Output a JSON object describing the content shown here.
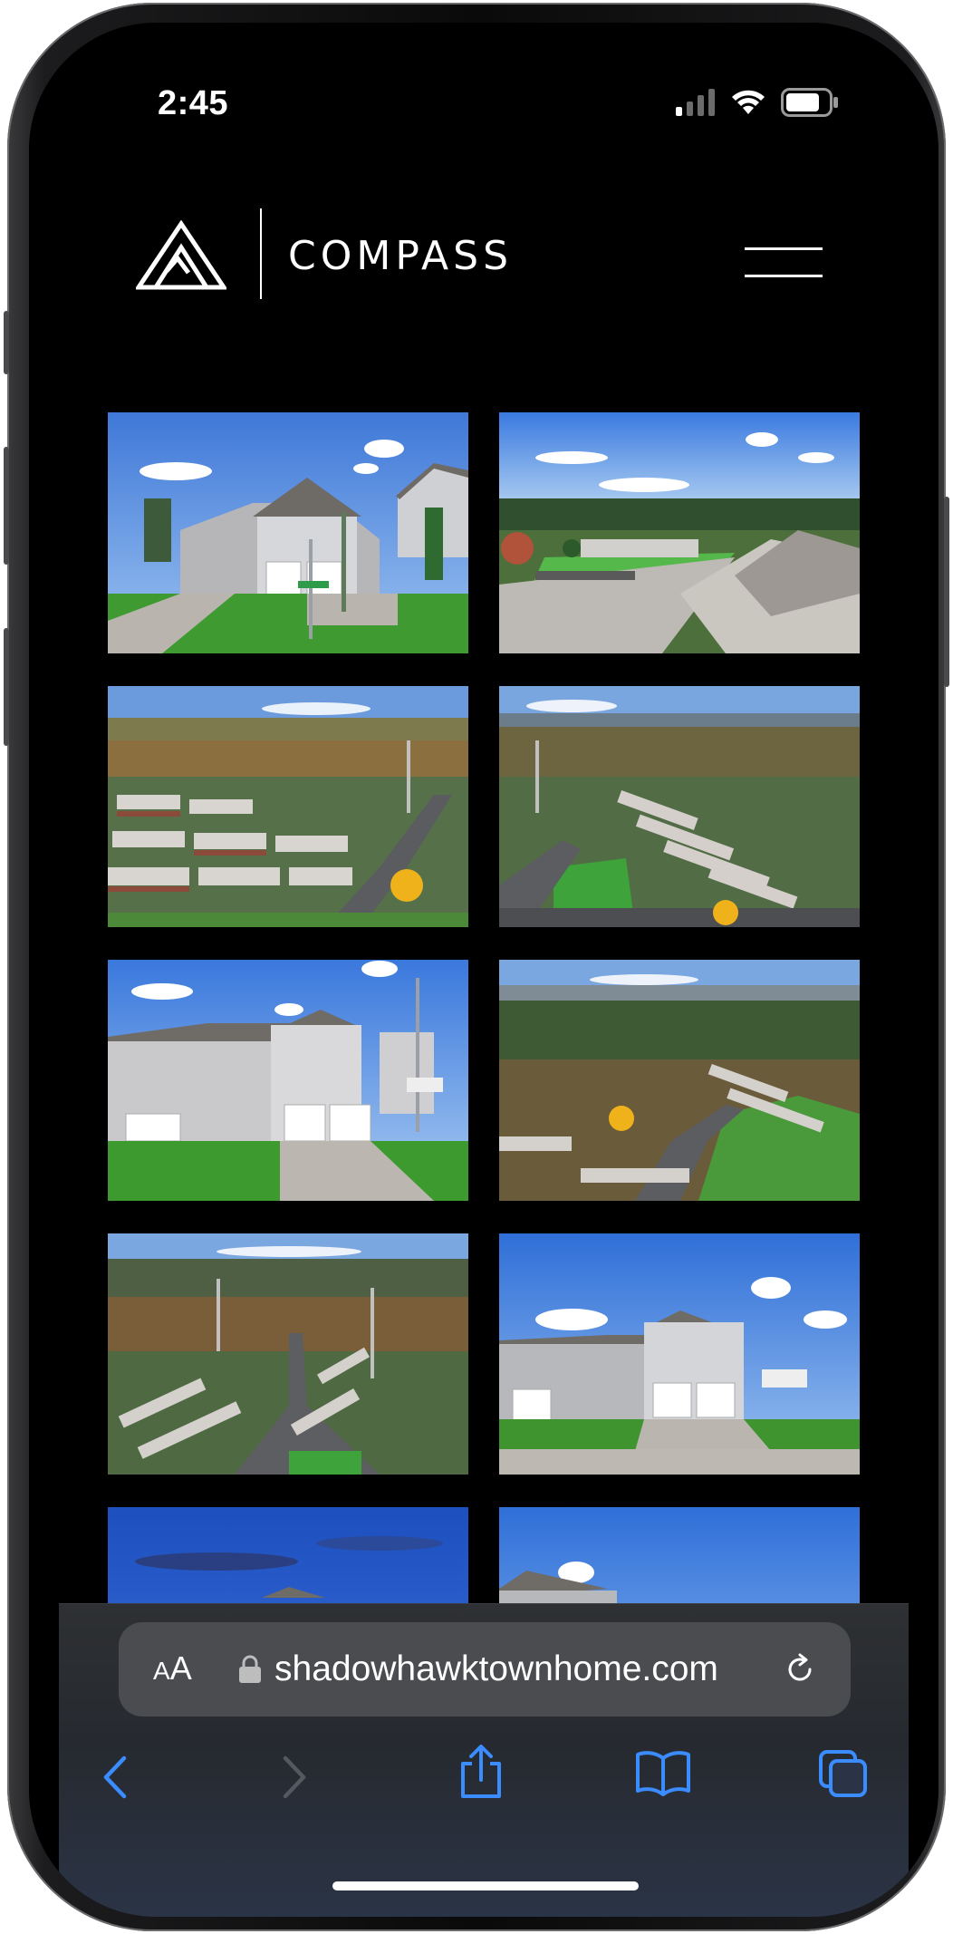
{
  "status_bar": {
    "time": "2:45",
    "signal_icon": "cellular-signal-icon",
    "wifi_icon": "wifi-icon",
    "battery_icon": "battery-icon"
  },
  "header": {
    "brand": "COMPASS",
    "logo_icon": "compass-mountain-logo",
    "menu_icon": "hamburger-menu-icon"
  },
  "gallery": {
    "photos": [
      {
        "subject": "house-front-corner"
      },
      {
        "subject": "aerial-parking-lot"
      },
      {
        "subject": "aerial-townhome-community"
      },
      {
        "subject": "aerial-neighborhood-wide"
      },
      {
        "subject": "house-front-garage"
      },
      {
        "subject": "aerial-valley-view"
      },
      {
        "subject": "aerial-powerlines-street"
      },
      {
        "subject": "house-front-wide"
      },
      {
        "subject": "evening-sky-house"
      },
      {
        "subject": "house-under-blue-sky"
      }
    ]
  },
  "browser": {
    "text_size_label": "AA",
    "url": "shadowhawktownhome.com",
    "lock_icon": "lock-icon",
    "reload_icon": "reload-icon",
    "toolbar": {
      "back_icon": "back-chevron-icon",
      "forward_icon": "forward-chevron-icon",
      "share_icon": "share-icon",
      "bookmarks_icon": "bookmarks-book-icon",
      "tabs_icon": "tabs-icon"
    },
    "accent_color": "#3b8cff",
    "disabled_color": "#55585e"
  }
}
